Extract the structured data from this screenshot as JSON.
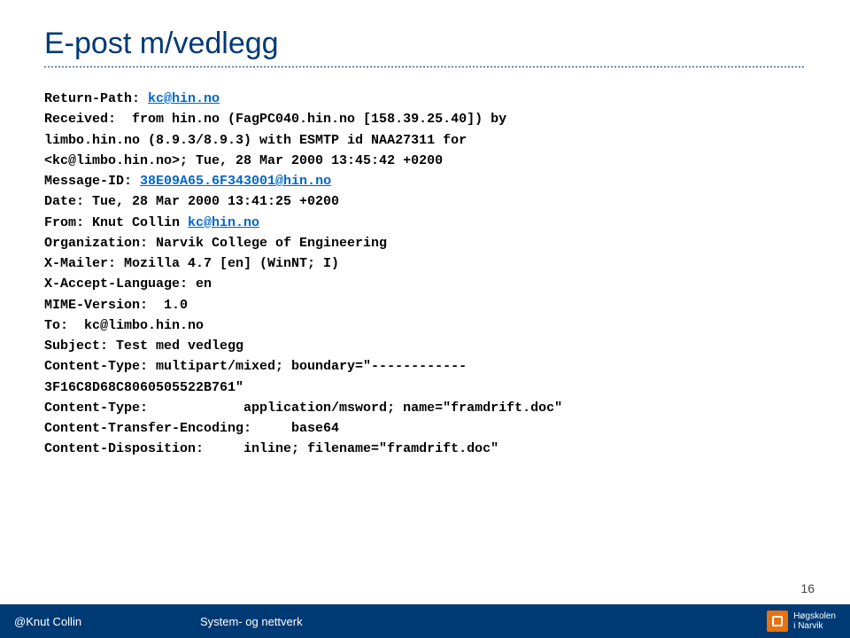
{
  "title": "E-post m/vedlegg",
  "email": {
    "l1a": "Return-Path: ",
    "l1link": "kc@hin.no",
    "l2": "Received:  from hin.no (FagPC040.hin.no [158.39.25.40]) by",
    "l3": "limbo.hin.no (8.9.3/8.9.3) with ESMTP id NAA27311 for",
    "l4": "<kc@limbo.hin.no>; Tue, 28 Mar 2000 13:45:42 +0200",
    "l5a": "Message-ID: ",
    "l5link": "38E09A65.6F343001@hin.no",
    "l6": "Date: Tue, 28 Mar 2000 13:41:25 +0200",
    "l7a": "From: Knut Collin ",
    "l7link": "kc@hin.no",
    "l8": "Organization: Narvik College of Engineering",
    "l9": "X-Mailer: Mozilla 4.7 [en] (WinNT; I)",
    "l10": "X-Accept-Language: en",
    "l11": "MIME-Version:  1.0",
    "l12": "To:  kc@limbo.hin.no",
    "l13": "Subject: Test med vedlegg",
    "l14": "Content-Type: multipart/mixed; boundary=\"------------",
    "l15": "3F16C8D68C8060505522B761\"",
    "l16": "Content-Type:            application/msword; name=\"framdrift.doc\"",
    "l17": "Content-Transfer-Encoding:     base64",
    "l18": "Content-Disposition:     inline; filename=\"framdrift.doc\""
  },
  "pagenum": "16",
  "footer": {
    "author": "@Knut Collin",
    "course": "System- og nettverk",
    "school1": "Høgskolen",
    "school2": "i Narvik"
  }
}
